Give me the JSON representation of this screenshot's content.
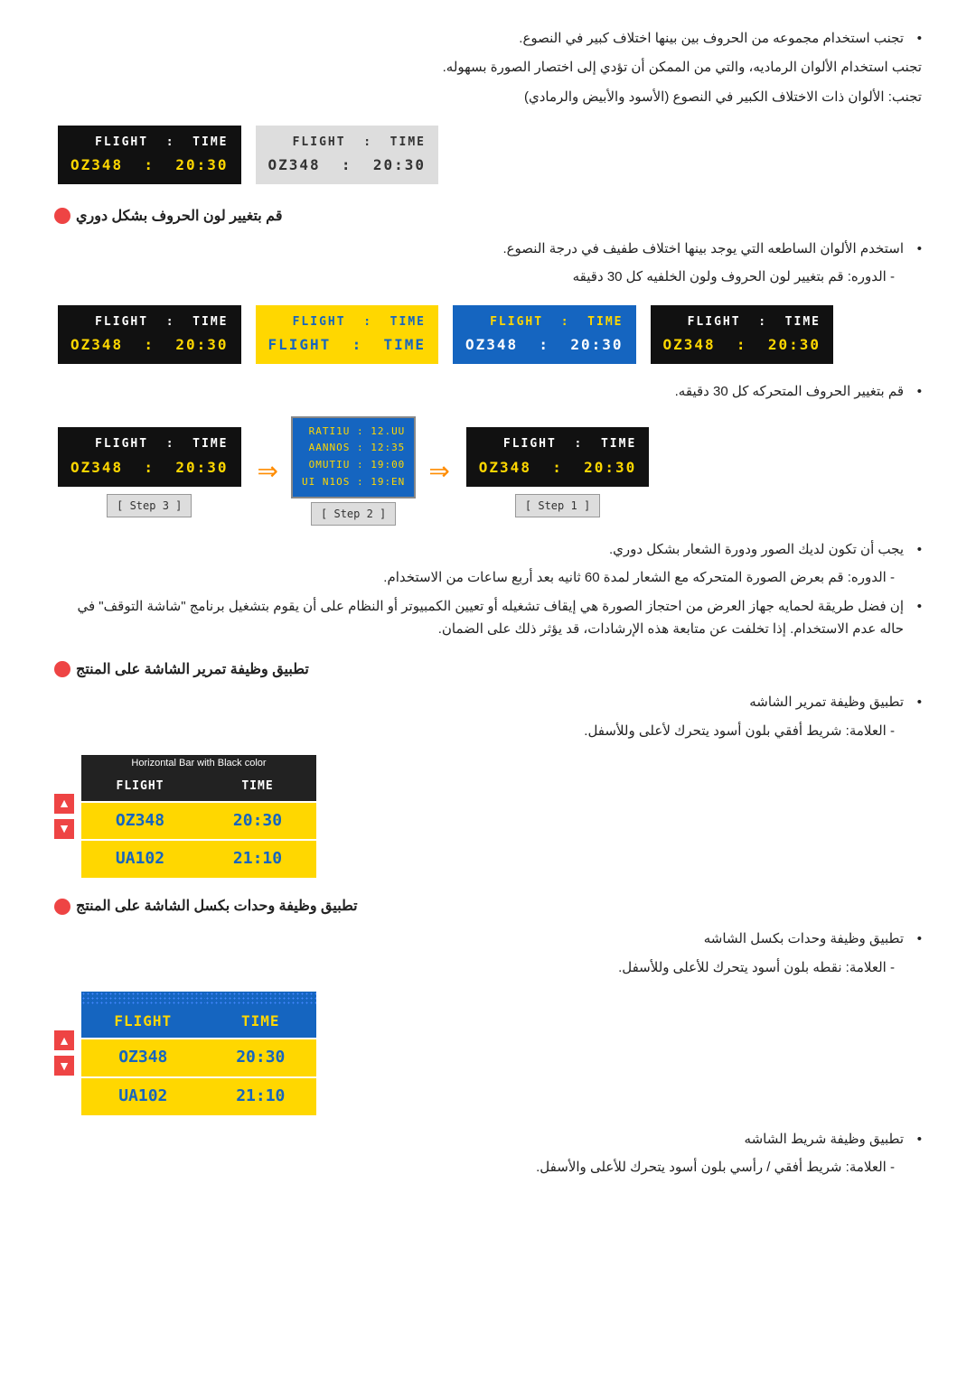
{
  "bullets": {
    "b1": "تجنب استخدام مجموعه من الحروف بين بينها اختلاف كبير في النصوع.",
    "b2": "تجنب استخدام الألوان الرماديه، والتي من الممكن أن تؤدي إلى اختصار الصورة بسهوله.",
    "b3": "تجنب: الألوان ذات الاختلاف الكبير في النصوع (الأسود والأبيض والرمادي)"
  },
  "section1": {
    "title": "قم بتغيير لون الحروف بشكل دوري",
    "b1": "استخدم الألوان الساطعه التي يوجد بينها اختلاف طفيف في درجة النصوع.",
    "sub1": "- الدوره: قم بتغيير لون الحروف ولون الخلفيه كل 30 دقيقه"
  },
  "section2": {
    "b1": "قم بتغيير الحروف المتحركه كل 30 دقيقه."
  },
  "section3": {
    "b1": "يجب أن تكون لديك الصور ودورة الشعار بشكل دوري.",
    "sub1": "- الدوره: قم بعرض الصورة المتحركه مع الشعار لمدة 60 ثانيه بعد أربع ساعات من الاستخدام.",
    "b2": "إن فضل طريقة لحمايه جهاز العرض من احتجاز الصورة هي إيقاف تشغيله أو تعيين الكمبيوتر أو النظام على أن يقوم بتشغيل برنامج \"شاشة التوقف\" في حاله عدم الاستخدام. إذا تخلفت عن متابعة هذه الإرشادات، قد يؤثر ذلك على الضمان."
  },
  "section4": {
    "title": "تطبيق وظيفة تمرير الشاشة على المنتج",
    "b1": "تطبيق وظيفة تمرير الشاشه",
    "sub1": "- العلامة: شريط أفقي بلون أسود يتحرك لأعلى وللأسفل."
  },
  "section5": {
    "title": "تطبيق وظيفة وحدات بكسل الشاشة على المنتج",
    "b1": "تطبيق وظيفة وحدات بكسل الشاشه",
    "sub1": "- العلامة: نقطه بلون أسود يتحرك للأعلى وللأسفل."
  },
  "section6": {
    "b1": "تطبيق وظيفة شريط الشاشه",
    "sub1": "- العلامة: شريط أفقي / رأسي بلون أسود يتحرك للأعلى والأسفل."
  },
  "flightData": {
    "header": "FLIGHT  :  TIME",
    "row1": "OZ348   :  20:30",
    "row2ua": "UA102   :  21:10",
    "f": "FLIGHT",
    "t": "TIME",
    "oz": "OZ348",
    "ua": "UA102",
    "time1": "20:30",
    "time2": "21:10"
  },
  "steps": {
    "step1": "[ Step 1 ]",
    "step2": "[ Step 2 ]",
    "step3": "[ Step 3 ]"
  },
  "tableHeader": "Horizontal Bar with Black color",
  "scrambled1": "RATI1U : 12.UU",
  "scrambled2": "AANNOS : 12:35",
  "scrambled3": "OMUTIU : 19:00",
  "scrambled4": "UI N1OS : 19:EN"
}
